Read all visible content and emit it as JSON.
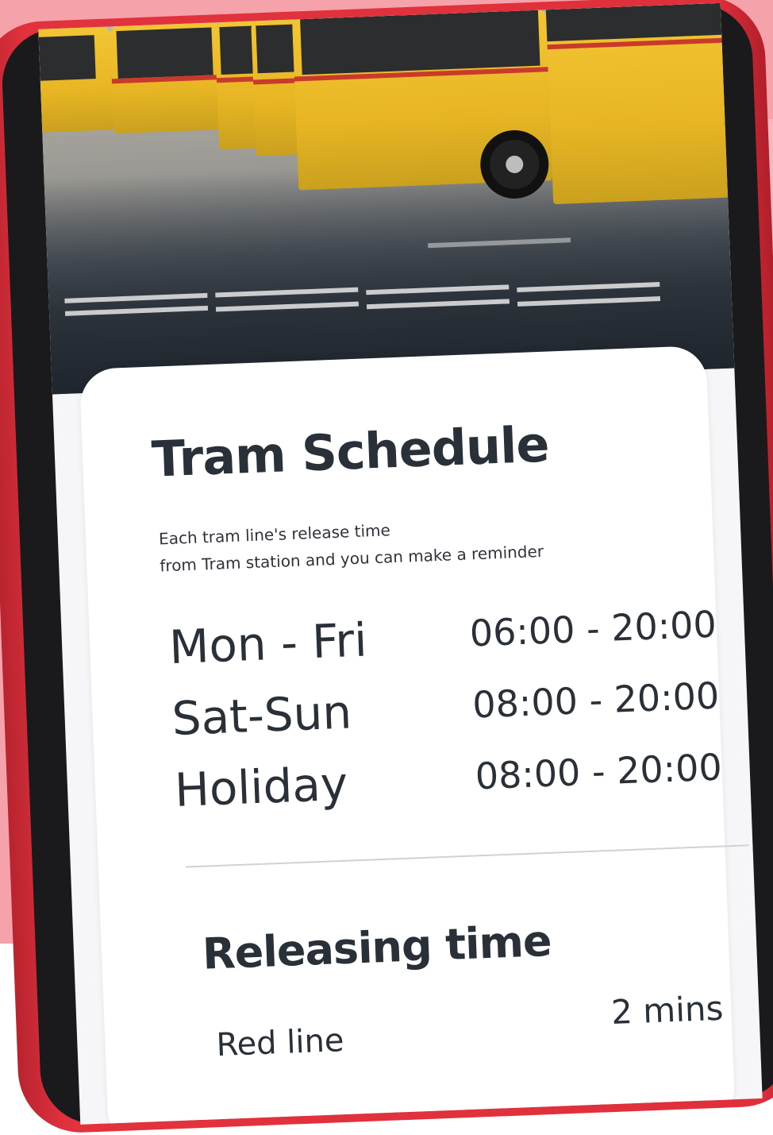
{
  "schedule": {
    "title": "Tram Schedule",
    "description_line1": "Each tram line's release time",
    "description_line2": "from Tram station and you can make a reminder",
    "rows": [
      {
        "day": "Mon - Fri",
        "hours": "06:00 - 20:00"
      },
      {
        "day": "Sat-Sun",
        "hours": "08:00 - 20:00"
      },
      {
        "day": "Holiday",
        "hours": "08:00 - 20:00"
      }
    ]
  },
  "releasing": {
    "title": "Releasing time",
    "lines": [
      {
        "name": "Red line",
        "value": "2 mins"
      }
    ]
  },
  "colors": {
    "background_pink": "#f6a2ab",
    "case_red": "#e0303c",
    "text_dark": "#2a3038",
    "bus_yellow": "#f3c533"
  }
}
